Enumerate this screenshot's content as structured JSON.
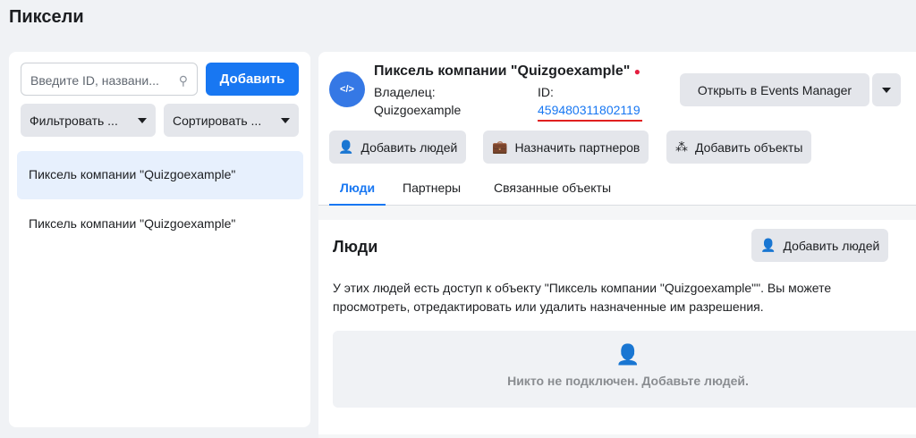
{
  "page_title": "Пиксели",
  "left": {
    "search_placeholder": "Введите ID, названи...",
    "add": "Добавить",
    "filter": "Фильтровать ...",
    "sort": "Сортировать ...",
    "items": [
      "Пиксель компании \"Quizgoexample\"",
      "Пиксель компании \"Quizgoexample\""
    ]
  },
  "detail": {
    "name": "Пиксель компании \"Quizgoexample\"",
    "owner_label": "Владелец:",
    "owner": "Quizgoexample",
    "id_label": "ID:",
    "id": "459480311802119",
    "open_events": "Открыть в Events Manager",
    "add_people": "Добавить людей",
    "assign_partners": "Назначить партнеров",
    "add_objects": "Добавить объекты",
    "tabs": [
      "Люди",
      "Партнеры",
      "Связанные объекты"
    ],
    "section_title": "Люди",
    "section_add": "Добавить людей",
    "description": "У этих людей есть доступ к объекту \"Пиксель компании \"Quizgoexample\"\". Вы можете просмотреть, отредактировать или удалить назначенные им разрешения.",
    "empty": "Никто не подключен. Добавьте людей."
  },
  "colors": {
    "accent": "#1877f2",
    "status": "#e41e3f",
    "underline": "#e02020"
  }
}
